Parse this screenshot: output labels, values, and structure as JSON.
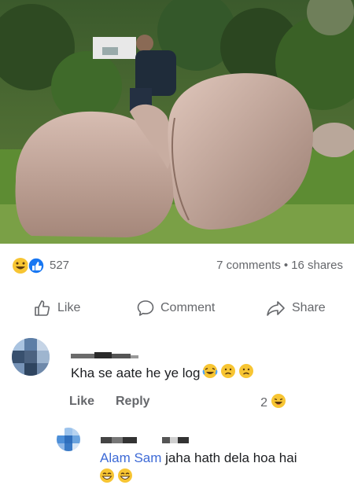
{
  "post": {
    "photo_alt": "",
    "reaction_icons": [
      "haha-icon",
      "like-icon"
    ],
    "reaction_count": "527",
    "comments_count": "7 comments",
    "separator": "•",
    "shares_count": "16 shares"
  },
  "actions": {
    "like_label": "Like",
    "comment_label": "Comment",
    "share_label": "Share"
  },
  "comments": [
    {
      "text": "Kha se aate he ye log",
      "emojis": [
        "laughing-crying-icon",
        "sad-icon",
        "sad-icon"
      ],
      "like_label": "Like",
      "reply_label": "Reply",
      "reaction_count": "2",
      "reaction_icon": "haha-icon"
    }
  ],
  "reply": {
    "author": "Alam Sam",
    "text": "jaha hath dela hoa hai",
    "emojis": [
      "grinning-icon",
      "grinning-icon"
    ]
  },
  "colors": {
    "secondary_text": "#65676b",
    "author_link": "#3d6ad6",
    "like_blue": "#1877f2",
    "haha_yellow": "#f7c533"
  }
}
